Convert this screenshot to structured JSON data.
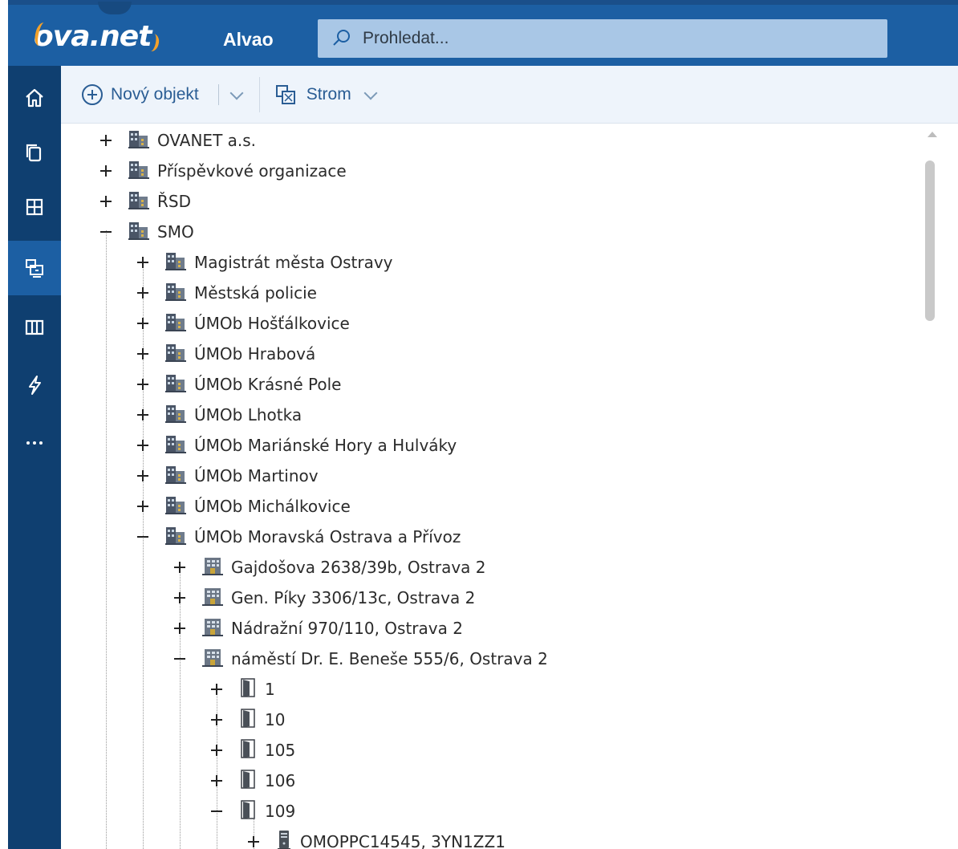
{
  "header": {
    "logo_text": "ova.net",
    "app_name": "Alvao",
    "search_placeholder": "Prohledat..."
  },
  "rail": {
    "items": [
      "home-icon",
      "copy-icon",
      "grid-icon",
      "assets-icon",
      "book-icon",
      "flash-icon",
      "more-icon"
    ],
    "active_index": 3
  },
  "toolbar": {
    "new_object_label": "Nový objekt",
    "view_label": "Strom"
  },
  "tree": {
    "rows": [
      {
        "label": "OVANET a.s.",
        "level": 0,
        "state": "collapsed",
        "icon": "building"
      },
      {
        "label": "Příspěvkové organizace",
        "level": 0,
        "state": "collapsed",
        "icon": "building"
      },
      {
        "label": "ŘSD",
        "level": 0,
        "state": "collapsed",
        "icon": "building"
      },
      {
        "label": "SMO",
        "level": 0,
        "state": "expanded",
        "icon": "building"
      },
      {
        "label": "Magistrát města Ostravy",
        "level": 1,
        "state": "collapsed",
        "icon": "building"
      },
      {
        "label": "Městská policie",
        "level": 1,
        "state": "collapsed",
        "icon": "building"
      },
      {
        "label": "ÚMOb Hošťálkovice",
        "level": 1,
        "state": "collapsed",
        "icon": "building"
      },
      {
        "label": "ÚMOb Hrabová",
        "level": 1,
        "state": "collapsed",
        "icon": "building"
      },
      {
        "label": "ÚMOb Krásné Pole",
        "level": 1,
        "state": "collapsed",
        "icon": "building"
      },
      {
        "label": "ÚMOb Lhotka",
        "level": 1,
        "state": "collapsed",
        "icon": "building"
      },
      {
        "label": "ÚMOb Mariánské Hory a Hulváky",
        "level": 1,
        "state": "collapsed",
        "icon": "building"
      },
      {
        "label": "ÚMOb Martinov",
        "level": 1,
        "state": "collapsed",
        "icon": "building"
      },
      {
        "label": "ÚMOb Michálkovice",
        "level": 1,
        "state": "collapsed",
        "icon": "building"
      },
      {
        "label": "ÚMOb Moravská Ostrava a Přívoz",
        "level": 1,
        "state": "expanded",
        "icon": "building"
      },
      {
        "label": "Gajdošova 2638/39b, Ostrava 2",
        "level": 2,
        "state": "collapsed",
        "icon": "address"
      },
      {
        "label": "Gen. Píky 3306/13c, Ostrava 2",
        "level": 2,
        "state": "collapsed",
        "icon": "address"
      },
      {
        "label": "Nádražní 970/110, Ostrava 2",
        "level": 2,
        "state": "collapsed",
        "icon": "address"
      },
      {
        "label": "náměstí Dr. E. Beneše 555/6, Ostrava 2",
        "level": 2,
        "state": "expanded",
        "icon": "address"
      },
      {
        "label": "1",
        "level": 3,
        "state": "collapsed",
        "icon": "room"
      },
      {
        "label": "10",
        "level": 3,
        "state": "collapsed",
        "icon": "room"
      },
      {
        "label": "105",
        "level": 3,
        "state": "collapsed",
        "icon": "room"
      },
      {
        "label": "106",
        "level": 3,
        "state": "collapsed",
        "icon": "room"
      },
      {
        "label": "109",
        "level": 3,
        "state": "expanded",
        "icon": "room"
      },
      {
        "label": "OMOPPC14545, 3YN1ZZ1",
        "level": 4,
        "state": "collapsed",
        "icon": "computer"
      }
    ]
  },
  "colors": {
    "header_bg": "#1c5fa3",
    "rail_bg": "#0f3f70",
    "accent": "#2a5d94",
    "logo_accent": "#f3a12a"
  }
}
